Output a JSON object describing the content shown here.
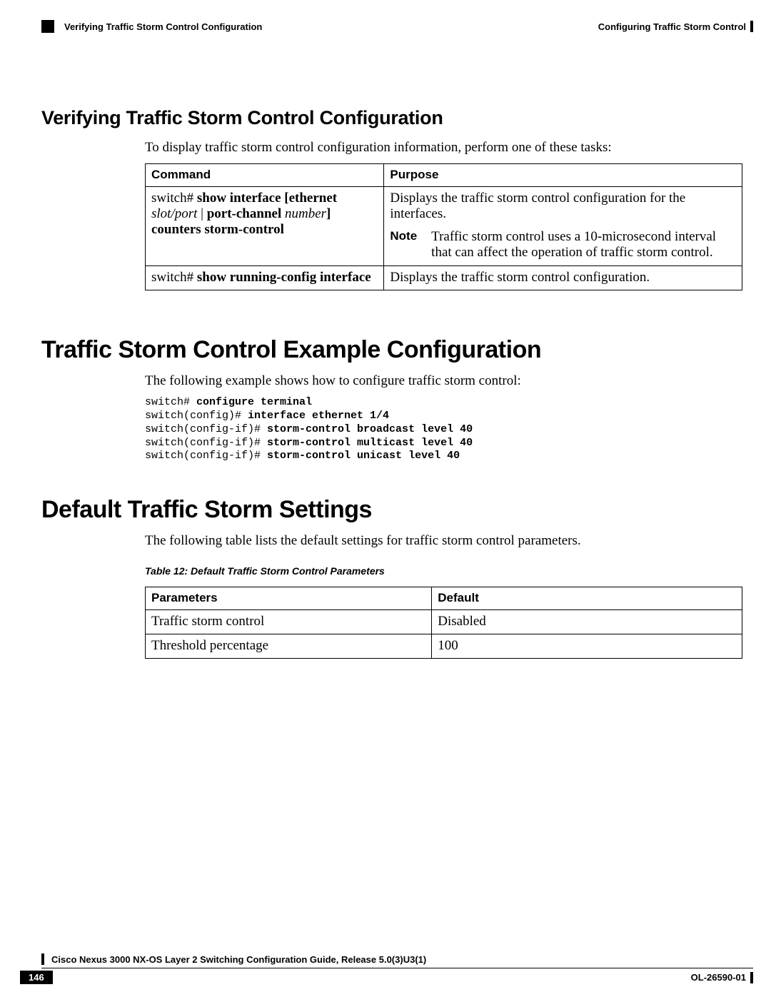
{
  "header": {
    "left": "Verifying Traffic Storm Control Configuration",
    "right": "Configuring Traffic Storm Control"
  },
  "verify": {
    "heading": "Verifying Traffic Storm Control Configuration",
    "intro": "To display traffic storm control configuration information, perform one of these tasks:",
    "col1": "Command",
    "col2": "Purpose",
    "row1": {
      "cmd_prefix": "switch# ",
      "cmd_b1": "show interface [ethernet ",
      "cmd_i1": "slot/port",
      "cmd_sep": " | ",
      "cmd_b2": "port-channel ",
      "cmd_i2": "number",
      "cmd_b3": "] counters storm-control",
      "purpose": "Displays the traffic storm control configuration for the interfaces.",
      "note_label": "Note",
      "note_text": "Traffic storm control uses a 10-microsecond interval that can affect the operation of traffic storm control."
    },
    "row2": {
      "cmd_prefix": "switch# ",
      "cmd_b1": "show running-config interface",
      "purpose": "Displays the traffic storm control configuration."
    }
  },
  "example": {
    "heading": "Traffic Storm Control Example Configuration",
    "intro": "The following example shows how to configure traffic storm control:",
    "code": {
      "l1p": "switch# ",
      "l1b": "configure terminal",
      "l2p": "switch(config)# ",
      "l2b": "interface ethernet 1/4",
      "l3p": "switch(config-if)# ",
      "l3b": "storm-control broadcast level 40",
      "l4p": "switch(config-if)# ",
      "l4b": "storm-control multicast level 40",
      "l5p": "switch(config-if)# ",
      "l5b": "storm-control unicast level 40"
    }
  },
  "defaults": {
    "heading": "Default Traffic Storm Settings",
    "intro": "The following table lists the default settings for traffic storm control parameters.",
    "caption": "Table 12: Default Traffic Storm Control Parameters",
    "col1": "Parameters",
    "col2": "Default",
    "r1c1": "Traffic storm control",
    "r1c2": "Disabled",
    "r2c1": "Threshold percentage",
    "r2c2": "100"
  },
  "footer": {
    "guide": "Cisco Nexus 3000 NX-OS Layer 2 Switching Configuration Guide, Release 5.0(3)U3(1)",
    "page": "146",
    "docid": "OL-26590-01"
  }
}
